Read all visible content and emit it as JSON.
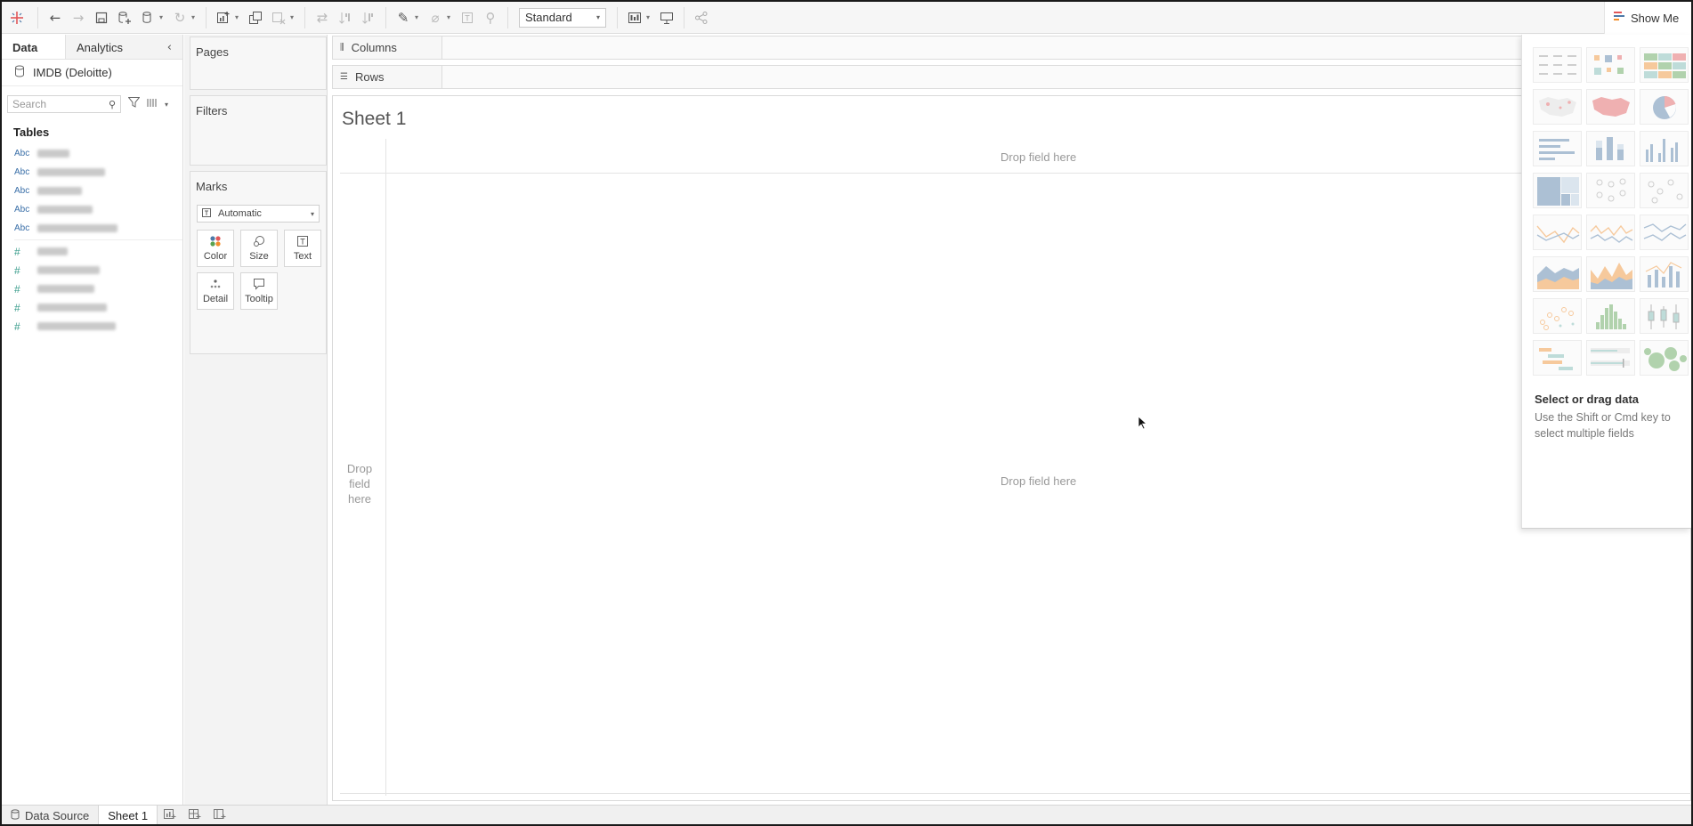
{
  "toolbar": {
    "icons": [
      "tableau-logo-icon",
      "undo-icon",
      "redo-icon",
      "save-icon",
      "new-datasource-icon",
      "datasource-icon",
      "refresh-icon",
      "new-worksheet-icon",
      "duplicate-sheet-icon",
      "clear-sheet-icon",
      "swap-icon",
      "sort-ascending-icon",
      "sort-descending-icon",
      "highlight-icon",
      "group-icon",
      "label-icon",
      "pin-icon",
      "show-cards-icon",
      "presentation-icon",
      "share-icon"
    ],
    "fit_select": "Standard",
    "show_me_label": "Show Me"
  },
  "data_pane": {
    "tabs": [
      "Data",
      "Analytics"
    ],
    "datasource_name": "IMDB (Deloitte)",
    "search_placeholder": "Search",
    "tables_heading": "Tables",
    "dimension_type_label": "Abc",
    "measure_type_label": "#"
  },
  "shelves": {
    "pages": "Pages",
    "filters": "Filters",
    "marks": "Marks",
    "mark_type": "Automatic",
    "mark_buttons": [
      "Color",
      "Size",
      "Text",
      "Detail",
      "Tooltip"
    ],
    "columns": "Columns",
    "rows": "Rows"
  },
  "canvas": {
    "sheet_title": "Sheet 1",
    "drop_top": "Drop field here",
    "drop_center": "Drop field here",
    "drop_left": "Drop field here"
  },
  "show_me": {
    "title": "Select or drag data",
    "hint": "Use the Shift or Cmd key to select multiple fields"
  },
  "bottom_tabs": {
    "data_source": "Data Source",
    "sheet": "Sheet 1"
  },
  "colors": {
    "accent_blue": "#4e79a7",
    "accent_orange": "#f28e2b",
    "accent_red": "#e15759",
    "accent_teal": "#76b7b2",
    "accent_green": "#59a14f"
  }
}
